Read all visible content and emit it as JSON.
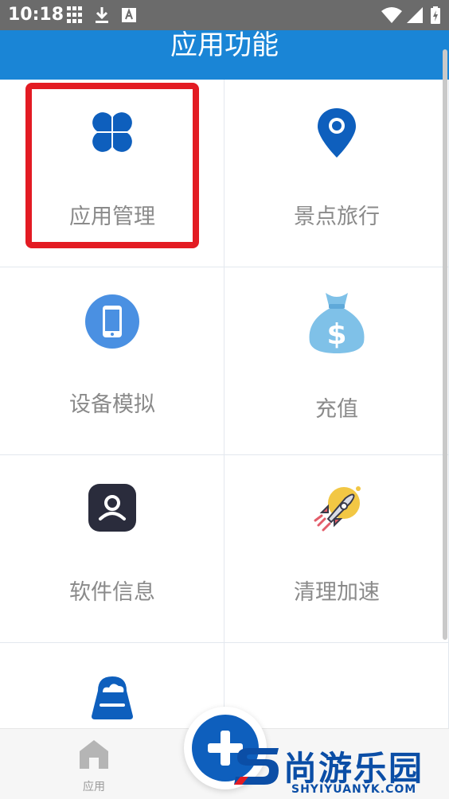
{
  "status_bar": {
    "time": "10:18"
  },
  "header": {
    "title": "应用功能"
  },
  "grid": [
    {
      "label": "应用管理",
      "icon": "clover-icon",
      "color": "#0e5fbd"
    },
    {
      "label": "景点旅行",
      "icon": "location-pin-icon",
      "color": "#0e5fbd"
    },
    {
      "label": "设备模拟",
      "icon": "phone-icon",
      "color": "#4a90e2"
    },
    {
      "label": "充值",
      "icon": "money-bag-icon",
      "color": "#7fc1e8"
    },
    {
      "label": "软件信息",
      "icon": "user-icon",
      "color": "#2a2c3c"
    },
    {
      "label": "清理加速",
      "icon": "rocket-icon",
      "color": "#f2c744"
    },
    {
      "icon": "cloud-storage-icon",
      "color": "#0e5fbd"
    }
  ],
  "bottom_nav": {
    "home_label": "应用"
  },
  "watermark": {
    "text": "尚游乐园",
    "sub": "SHYIYUANYK.COM"
  },
  "colors": {
    "header": "#1a85d6",
    "highlight": "#e31b23",
    "label": "#8a8a8a"
  }
}
